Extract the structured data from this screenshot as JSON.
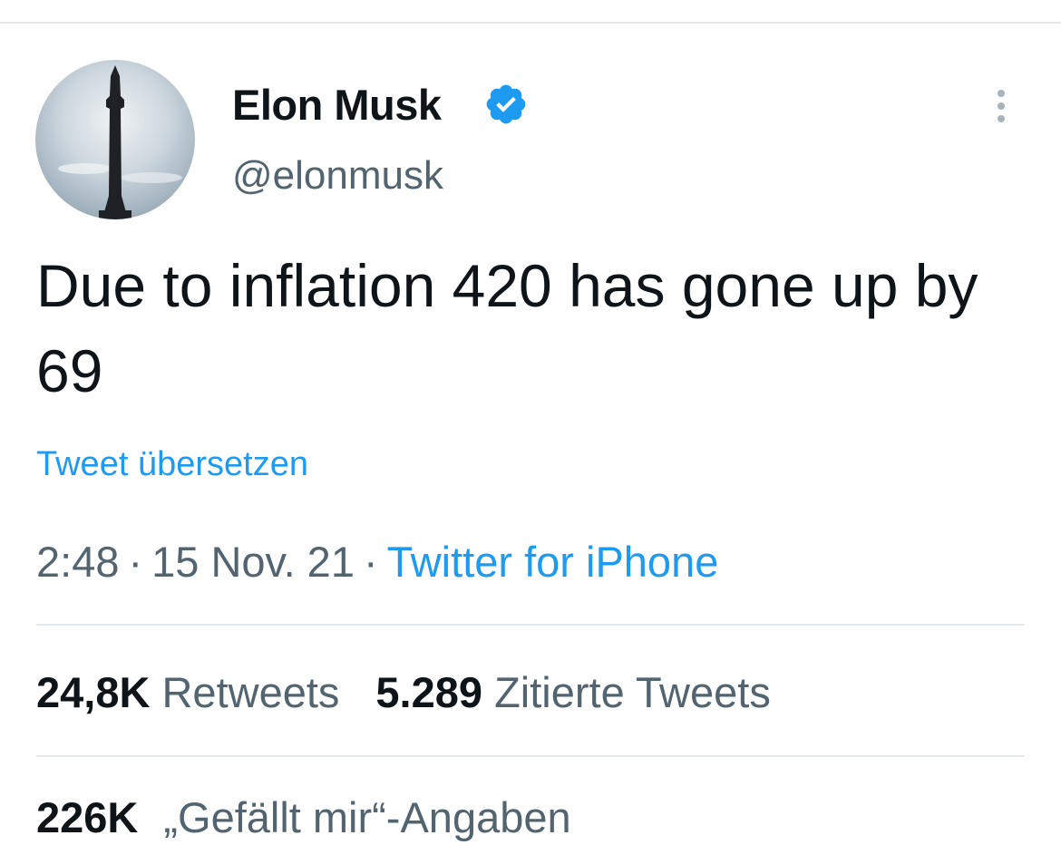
{
  "author": {
    "name": "Elon Musk",
    "handle": "@elonmusk",
    "verified": true
  },
  "tweet": {
    "text": "Due to inflation 420 has gone up by 69",
    "translate_label": "Tweet übersetzen",
    "time": "2:48",
    "date": "15 Nov. 21",
    "separator": "·",
    "source": "Twitter for iPhone"
  },
  "stats": {
    "retweets_count": "24,8K",
    "retweets_label": "Retweets",
    "quotes_count": "5.289",
    "quotes_label": "Zitierte Tweets",
    "likes_count": "226K",
    "likes_label": "„Gefällt mir“-Angaben"
  },
  "icons": {
    "verified": "verified-badge-icon",
    "more": "more-options-icon"
  },
  "colors": {
    "link": "#1d9bf0",
    "text": "#0f1419",
    "secondary": "#536471",
    "divider": "#e6e9ec"
  }
}
